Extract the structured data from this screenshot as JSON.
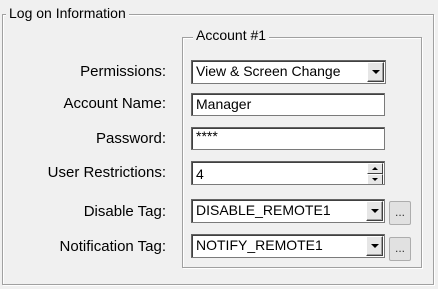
{
  "group": {
    "title": "Log on Information",
    "account_title": "Account #1"
  },
  "fields": {
    "permissions": {
      "label": "Permissions:",
      "value": "View & Screen Change"
    },
    "account_name": {
      "label": "Account Name:",
      "value": "Manager"
    },
    "password": {
      "label": "Password:",
      "value": "****"
    },
    "user_restrictions": {
      "label": "User Restrictions:",
      "value": "4"
    },
    "disable_tag": {
      "label": "Disable Tag:",
      "value": "DISABLE_REMOTE1",
      "browse": "..."
    },
    "notification_tag": {
      "label": "Notification Tag:",
      "value": "NOTIFY_REMOTE1",
      "browse": "..."
    }
  },
  "icons": {
    "dropdown": "chevron-down-icon",
    "spin_up": "arrow-up-icon",
    "spin_down": "arrow-down-icon"
  }
}
